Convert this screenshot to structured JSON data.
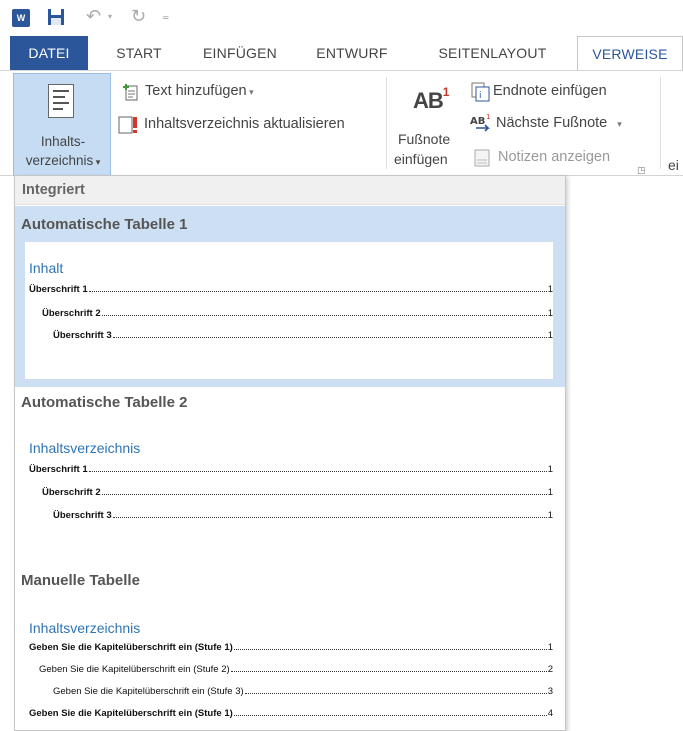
{
  "tabs": {
    "file": "DATEI",
    "start": "START",
    "insert": "EINFÜGEN",
    "design": "ENTWURF",
    "layout": "SEITENLAYOUT",
    "references": "VERWEISE"
  },
  "ribbon": {
    "toc_label_1": "Inhalts-",
    "toc_label_2": "verzeichnis",
    "add_text": "Text hinzufügen",
    "update_toc": "Inhaltsverzeichnis aktualisieren",
    "insert_footnote_1": "Fußnote",
    "insert_footnote_2": "einfügen",
    "insert_endnote": "Endnote einfügen",
    "next_footnote": "Nächste Fußnote",
    "show_notes": "Notizen anzeigen",
    "cut_label": "ei",
    "ab_text": "AB",
    "ab_superscript": "1"
  },
  "gallery": {
    "header": "Integriert",
    "sections": [
      {
        "title": "Automatische Tabelle 1",
        "heading": "Inhalt",
        "lines": [
          {
            "text": "Überschrift 1",
            "page": "1"
          },
          {
            "text": "Überschrift 2",
            "page": "1"
          },
          {
            "text": "Überschrift 3",
            "page": "1"
          }
        ]
      },
      {
        "title": "Automatische Tabelle 2",
        "heading": "Inhaltsverzeichnis",
        "lines": [
          {
            "text": "Überschrift 1",
            "page": "1"
          },
          {
            "text": "Überschrift 2",
            "page": "1"
          },
          {
            "text": "Überschrift 3",
            "page": "1"
          }
        ]
      },
      {
        "title": "Manuelle Tabelle",
        "heading": "Inhaltsverzeichnis",
        "lines": [
          {
            "text": "Geben Sie die Kapitelüberschrift ein (Stufe 1)",
            "page": "1"
          },
          {
            "text": "Geben Sie die Kapitelüberschrift ein (Stufe 2)",
            "page": "2"
          },
          {
            "text": "Geben Sie die Kapitelüberschrift ein (Stufe 3)",
            "page": "3"
          },
          {
            "text": "Geben Sie die Kapitelüberschrift ein (Stufe 1)",
            "page": "4"
          }
        ]
      }
    ]
  },
  "colors": {
    "accent": "#2b579a",
    "selected": "#cde0f3",
    "toc_heading": "#2e74b5"
  }
}
